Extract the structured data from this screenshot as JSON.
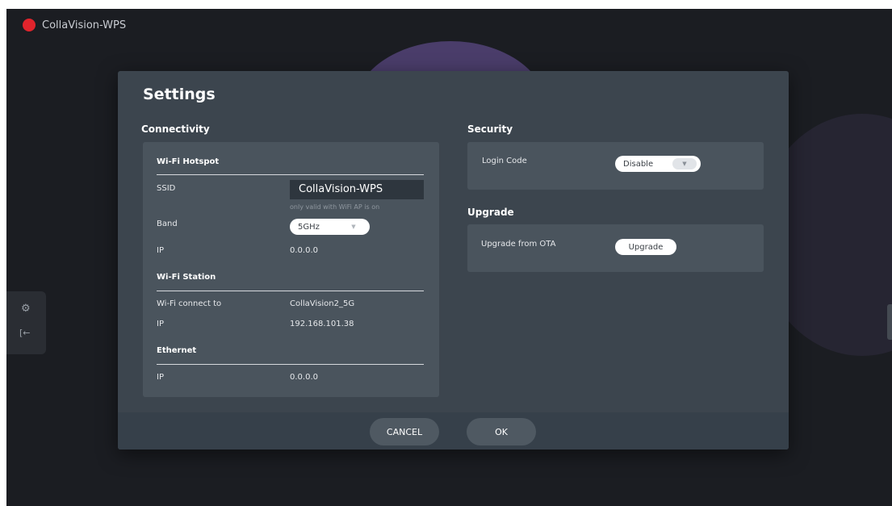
{
  "app": {
    "title": "CollaVision-WPS"
  },
  "dialog": {
    "title": "Settings",
    "connectivity": {
      "title": "Connectivity",
      "wifi_hotspot": {
        "heading": "Wi-Fi Hotspot",
        "ssid_label": "SSID",
        "ssid_value": "CollaVision-WPS",
        "ssid_hint": "only valid with WiFi AP is on",
        "band_label": "Band",
        "band_value": "5GHz",
        "ip_label": "IP",
        "ip_value": "0.0.0.0"
      },
      "wifi_station": {
        "heading": "Wi-Fi Station",
        "connect_label": "Wi-Fi connect to",
        "connect_value": "CollaVision2_5G",
        "ip_label": "IP",
        "ip_value": "192.168.101.38"
      },
      "ethernet": {
        "heading": "Ethernet",
        "ip_label": "IP",
        "ip_value": "0.0.0.0"
      }
    },
    "security": {
      "title": "Security",
      "login_code_label": "Login Code",
      "login_code_value": "Disable"
    },
    "upgrade": {
      "title": "Upgrade",
      "ota_label": "Upgrade from OTA",
      "ota_button": "Upgrade"
    },
    "footer": {
      "cancel": "CANCEL",
      "ok": "OK"
    }
  },
  "icons": {
    "caret": "▼",
    "settings": "⚙",
    "logout": "[←"
  },
  "colors": {
    "record": "#e0242c",
    "dialog": "#3c454e",
    "panel": "#4a545d"
  }
}
